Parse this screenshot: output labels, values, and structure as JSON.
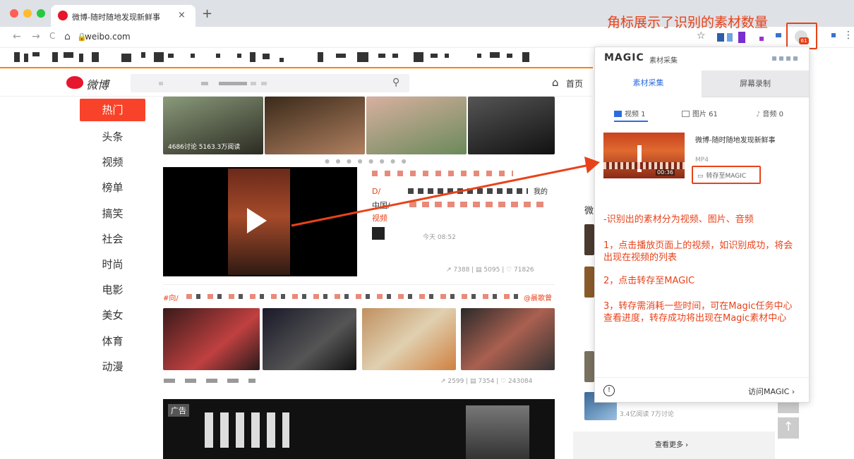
{
  "browser": {
    "tab_title": "微博-随时随地发现新鲜事",
    "tab_close": "×",
    "new_tab": "+",
    "url": "weibo.com",
    "back": "←",
    "forward": "→",
    "reload": "C",
    "home": "⌂",
    "star": "☆",
    "menu": "⋮",
    "ext_badge": "61"
  },
  "annotation_top": "角标展示了识别的素材数量",
  "weibo": {
    "logo_text": "微博",
    "home_label": "首页",
    "nav": [
      "热门",
      "头条",
      "视频",
      "榜单",
      "搞笑",
      "社会",
      "时尚",
      "电影",
      "美女",
      "体育",
      "动漫"
    ],
    "carousel_caption": "4686讨论   5163.3万阅读",
    "carousel_dots": "● ● ● ● ● ● ● ●",
    "post_time": "今天 08:52",
    "post_stats": "↗ 7388 | ▤ 5095 | ♡ 71826",
    "post2_stats": "↗ 2599 | ▤ 7354 | ♡ 243084",
    "ad_tag": "广告",
    "red_text": "D/",
    "black_text": "中国/",
    "my_text": "我的",
    "red_prefix": "#向/",
    "at_user": "@晨歌曾",
    "short_side": "微",
    "read_count": "3.4亿阅读 7万讨论",
    "see_more": "查看更多 ›",
    "up_arrow": "↑",
    "video_link": "视频"
  },
  "popup": {
    "logo": "MAGIC",
    "logo_sub": "素材采集",
    "tab_collect": "素材采集",
    "tab_record": "屏幕录制",
    "sub_video": "视频 1",
    "sub_image": "图片 61",
    "sub_audio": "音频 0",
    "item_title": "微博-随时随地发现新鲜事",
    "item_format": "MP4",
    "item_duration": "00:36",
    "save_btn": "转存至MAGIC",
    "info_icon": "!",
    "visit": "访问MAGIC ›"
  },
  "annotations": {
    "a1": "-识别出的素材分为视频、图片、音频",
    "a2": "1，点击播放页面上的视频，如识别成功，将会出现在视频的列表",
    "a3": "2，点击转存至MAGIC",
    "a4": "3，转存需消耗一些时间，可在Magic任务中心查看进度，转存成功将出现在Magic素材中心"
  },
  "colors": {
    "accent": "#e8421a",
    "weibo_orange": "#ff8200",
    "active_nav": "#f8432a",
    "link_blue": "#2d6cdf"
  }
}
